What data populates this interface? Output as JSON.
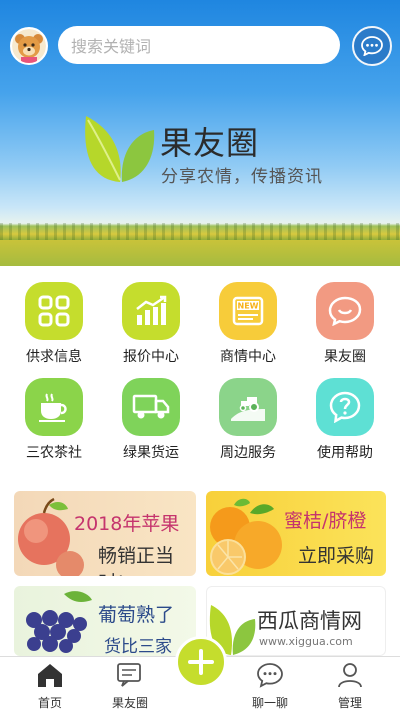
{
  "search": {
    "placeholder": "搜索关键词"
  },
  "brand": {
    "title": "果友圈",
    "subtitle": "分享农情，传播资讯"
  },
  "grid": [
    {
      "label": "供求信息",
      "icon": "grid-icon",
      "color": "#c5dd2d"
    },
    {
      "label": "报价中心",
      "icon": "chart-icon",
      "color": "#c5dd2d"
    },
    {
      "label": "商情中心",
      "icon": "news-icon",
      "color": "#f7cc3a"
    },
    {
      "label": "果友圈",
      "icon": "chat-heart-icon",
      "color": "#f29a82"
    },
    {
      "label": "三农茶社",
      "icon": "tea-cup-icon",
      "color": "#8bd44a"
    },
    {
      "label": "绿果货运",
      "icon": "truck-icon",
      "color": "#7fd35a"
    },
    {
      "label": "周边服务",
      "icon": "tractor-icon",
      "color": "#8bd48a"
    },
    {
      "label": "使用帮助",
      "icon": "help-icon",
      "color": "#5ee0d4"
    }
  ],
  "promos": [
    {
      "line1": "2018年苹果",
      "line2": "畅销正当时!"
    },
    {
      "line1": "蜜桔/脐橙",
      "line2": "立即采购"
    },
    {
      "line1": "葡萄熟了",
      "line2": "货比三家"
    },
    {
      "line1": "西瓜商情网",
      "line2": "www.xiggua.com"
    }
  ],
  "tabs": [
    {
      "label": "首页",
      "icon": "home-icon"
    },
    {
      "label": "果友圈",
      "icon": "chat-bubbles-icon"
    },
    {
      "label": "聊一聊",
      "icon": "chat-dots-icon"
    },
    {
      "label": "管理",
      "icon": "user-icon"
    }
  ],
  "colors": {
    "accent": "#c5dd2d",
    "sky": "#1f86e0"
  }
}
